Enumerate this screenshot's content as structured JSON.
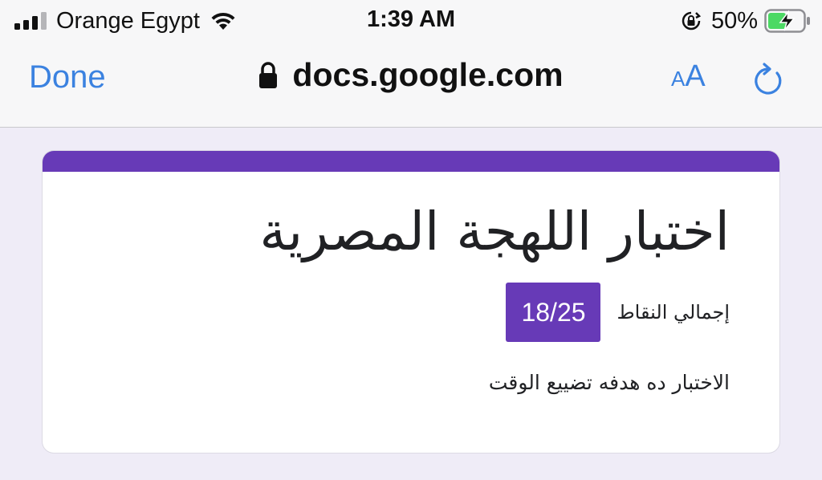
{
  "status_bar": {
    "carrier": "Orange Egypt",
    "time": "1:39 AM",
    "battery_percent": "50%",
    "icons": [
      "signal-icon",
      "wifi-icon",
      "rotation-lock-icon",
      "battery-charging-icon"
    ]
  },
  "browser": {
    "done_label": "Done",
    "url": "docs.google.com",
    "text_size_small": "A",
    "text_size_large": "A",
    "accent_color": "#3b82e0"
  },
  "form": {
    "title": "اختبار اللهجة المصرية",
    "score_label": "إجمالي النقاط",
    "score_value": "18/25",
    "description": "الاختبار ده هدفه تضييع الوقت",
    "theme_color": "#673ab7"
  }
}
